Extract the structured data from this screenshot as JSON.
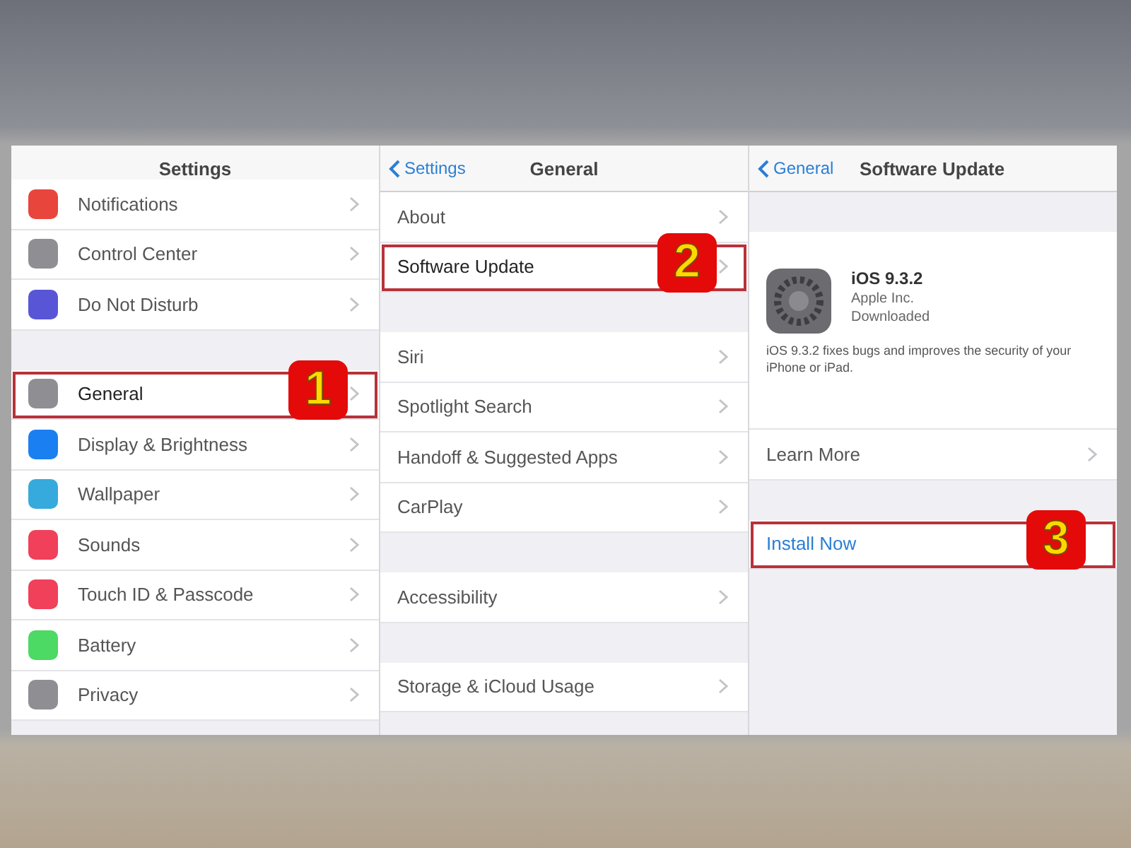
{
  "panels": [
    {
      "title": "Settings",
      "items": [
        {
          "kind": "row",
          "label": "Notifications",
          "color": "#e8453c"
        },
        {
          "kind": "row",
          "label": "Control Center",
          "color": "#8e8e93"
        },
        {
          "kind": "row",
          "label": "Do Not Disturb",
          "color": "#5856d6"
        },
        {
          "kind": "gap"
        },
        {
          "kind": "row",
          "label": "General",
          "color": "#8e8e93",
          "step": "1"
        },
        {
          "kind": "row",
          "label": "Display & Brightness",
          "color": "#1a7ff0"
        },
        {
          "kind": "row",
          "label": "Wallpaper",
          "color": "#36aadc"
        },
        {
          "kind": "row",
          "label": "Sounds",
          "color": "#f0405a"
        },
        {
          "kind": "row",
          "label": "Touch ID & Passcode",
          "color": "#f0405a"
        },
        {
          "kind": "row",
          "label": "Battery",
          "color": "#4cd964"
        },
        {
          "kind": "row",
          "label": "Privacy",
          "color": "#8e8e93"
        }
      ]
    },
    {
      "title": "General",
      "back": "Settings",
      "items": [
        {
          "kind": "row",
          "label": "About"
        },
        {
          "kind": "row",
          "label": "Software Update",
          "step": "2"
        },
        {
          "kind": "gap"
        },
        {
          "kind": "row",
          "label": "Siri"
        },
        {
          "kind": "row",
          "label": "Spotlight Search"
        },
        {
          "kind": "row",
          "label": "Handoff & Suggested Apps"
        },
        {
          "kind": "row",
          "label": "CarPlay"
        },
        {
          "kind": "gap"
        },
        {
          "kind": "row",
          "label": "Accessibility"
        },
        {
          "kind": "gap"
        },
        {
          "kind": "row",
          "label": "Storage & iCloud Usage"
        }
      ]
    },
    {
      "title": "Software Update",
      "back": "General",
      "items": [
        {
          "kind": "gap"
        },
        {
          "kind": "update",
          "name": "iOS 9.3.2",
          "vendor": "Apple Inc.",
          "status": "Downloaded",
          "description": "iOS 9.3.2 fixes bugs and improves the security of your iPhone or iPad."
        },
        {
          "kind": "row",
          "label": "Learn More"
        },
        {
          "kind": "gap"
        },
        {
          "kind": "action",
          "label": "Install Now",
          "step": "3"
        }
      ]
    }
  ]
}
